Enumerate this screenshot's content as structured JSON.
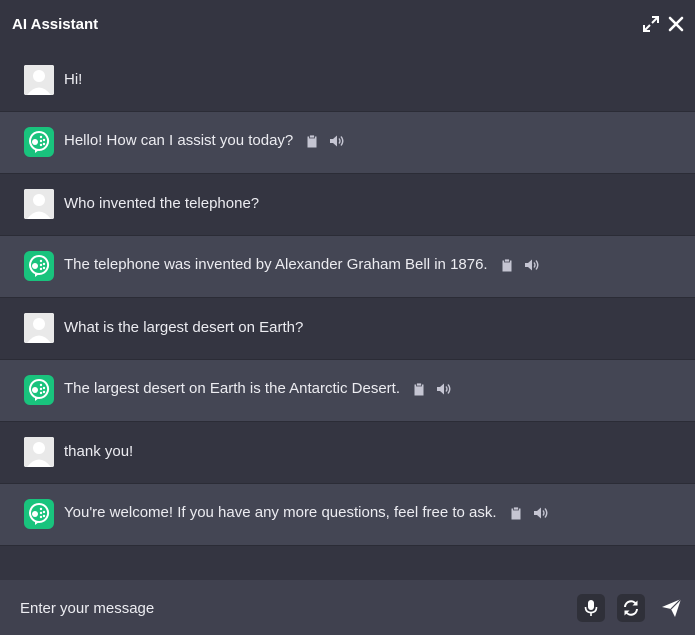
{
  "header": {
    "title": "AI Assistant",
    "expand_icon": "expand-icon",
    "close_icon": "close-icon"
  },
  "messages": [
    {
      "role": "user",
      "text": "Hi!"
    },
    {
      "role": "assistant",
      "text": "Hello! How can I assist you today?"
    },
    {
      "role": "user",
      "text": "Who invented the telephone?"
    },
    {
      "role": "assistant",
      "text": "The telephone was invented by Alexander Graham Bell in 1876."
    },
    {
      "role": "user",
      "text": "What is the largest desert on Earth?"
    },
    {
      "role": "assistant",
      "text": "The largest desert on Earth is the Antarctic Desert."
    },
    {
      "role": "user",
      "text": "thank you!"
    },
    {
      "role": "assistant",
      "text": "You're welcome! If you have any more questions, feel free to ask."
    }
  ],
  "composer": {
    "placeholder": "Enter your message",
    "mic_icon": "microphone-icon",
    "refresh_icon": "refresh-icon",
    "send_icon": "send-icon"
  },
  "colors": {
    "background": "#343541",
    "bot_row": "#444654",
    "composer": "#40414f",
    "bot_avatar": "#19c37d"
  }
}
